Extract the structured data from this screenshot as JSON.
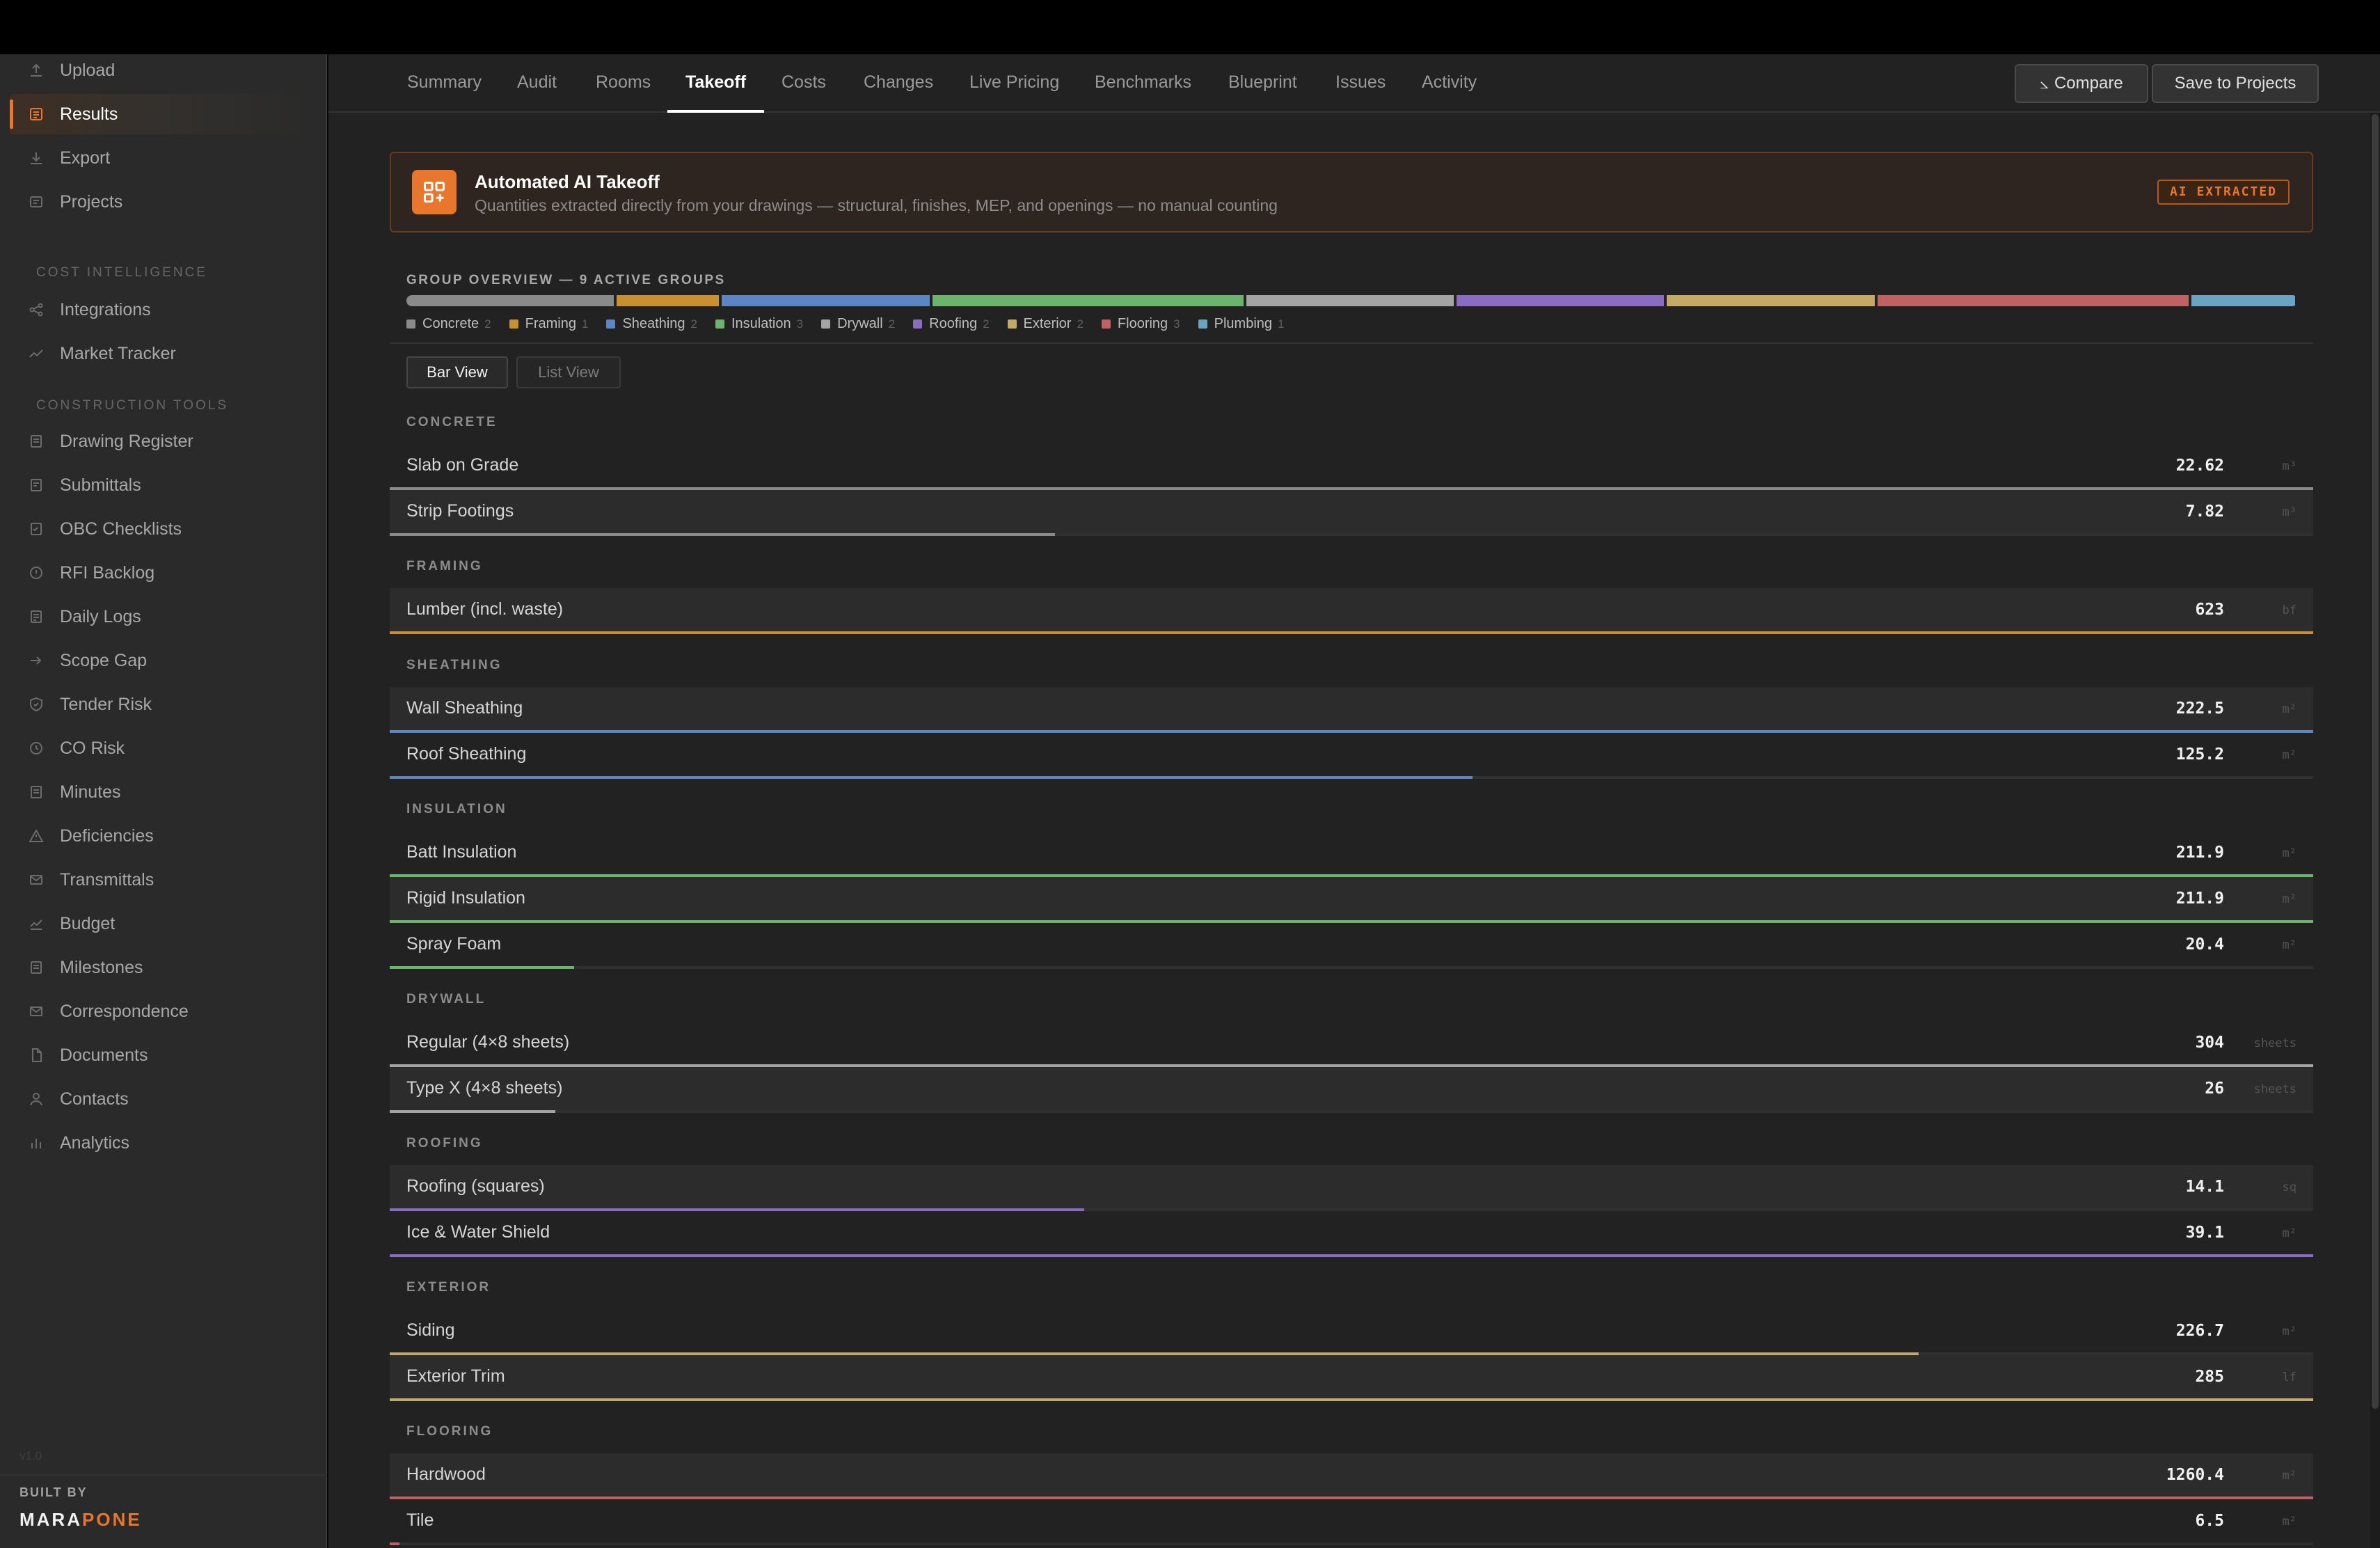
{
  "sidebar": {
    "top_items": [
      {
        "label": "Upload",
        "icon": "upload-icon"
      },
      {
        "label": "Results",
        "icon": "results-icon",
        "active": true
      },
      {
        "label": "Export",
        "icon": "export-icon"
      },
      {
        "label": "Projects",
        "icon": "projects-icon"
      }
    ],
    "cost_intelligence_heading": "COST INTELLIGENCE",
    "cost_items": [
      {
        "label": "Integrations",
        "icon": "integrations-icon"
      },
      {
        "label": "Market Tracker",
        "icon": "market-tracker-icon"
      }
    ],
    "construction_tools_heading": "CONSTRUCTION TOOLS",
    "tool_items": [
      {
        "label": "Drawing Register",
        "icon": "drawing-register-icon"
      },
      {
        "label": "Submittals",
        "icon": "submittals-icon"
      },
      {
        "label": "OBC Checklists",
        "icon": "checklist-icon"
      },
      {
        "label": "RFI Backlog",
        "icon": "rfi-icon"
      },
      {
        "label": "Daily Logs",
        "icon": "daily-logs-icon"
      },
      {
        "label": "Scope Gap",
        "icon": "scope-gap-icon"
      },
      {
        "label": "Tender Risk",
        "icon": "tender-risk-icon"
      },
      {
        "label": "CO Risk",
        "icon": "co-risk-icon"
      },
      {
        "label": "Minutes",
        "icon": "minutes-icon"
      },
      {
        "label": "Deficiencies",
        "icon": "deficiencies-icon"
      },
      {
        "label": "Transmittals",
        "icon": "transmittals-icon"
      },
      {
        "label": "Budget",
        "icon": "budget-icon"
      },
      {
        "label": "Milestones",
        "icon": "milestones-icon"
      },
      {
        "label": "Correspondence",
        "icon": "correspondence-icon"
      },
      {
        "label": "Documents",
        "icon": "documents-icon"
      },
      {
        "label": "Contacts",
        "icon": "contacts-icon"
      },
      {
        "label": "Analytics",
        "icon": "analytics-icon"
      }
    ],
    "version": "v1.0",
    "built_by": "BUILT BY",
    "brand_a": "MARA",
    "brand_b": "PONE"
  },
  "tabs": [
    "Summary",
    "Audit",
    "Rooms",
    "Takeoff",
    "Costs",
    "Changes",
    "Live Pricing",
    "Benchmarks",
    "Blueprint",
    "Issues",
    "Activity"
  ],
  "active_tab": "Takeoff",
  "actions": {
    "compare": "Compare",
    "save": "Save to Projects"
  },
  "banner": {
    "title": "Automated AI Takeoff",
    "subtitle": "Quantities extracted directly from your drawings — structural, finishes, MEP, and openings — no manual counting",
    "badge": "AI EXTRACTED"
  },
  "overview": {
    "title": "GROUP OVERVIEW — 9 ACTIVE GROUPS",
    "groups": [
      {
        "name": "Concrete",
        "count": "2",
        "color": "#8a8a8a"
      },
      {
        "name": "Framing",
        "count": "1",
        "color": "#c8902e"
      },
      {
        "name": "Sheathing",
        "count": "2",
        "color": "#5a86c4"
      },
      {
        "name": "Insulation",
        "count": "3",
        "color": "#6cb36c"
      },
      {
        "name": "Drywall",
        "count": "2",
        "color": "#a4a4a4"
      },
      {
        "name": "Roofing",
        "count": "2",
        "color": "#8a6cc2"
      },
      {
        "name": "Exterior",
        "count": "2",
        "color": "#c4aa66"
      },
      {
        "name": "Flooring",
        "count": "3",
        "color": "#c06262"
      },
      {
        "name": "Plumbing",
        "count": "1",
        "color": "#6aa4c4"
      }
    ]
  },
  "view_toggle": {
    "bar": "Bar View",
    "list": "List View",
    "active": "bar"
  },
  "sections": [
    {
      "heading": "CONCRETE",
      "color": "#8a8a8a",
      "items": [
        {
          "label": "Slab on Grade",
          "value": "22.62",
          "unit": "m³",
          "fraction": 1.0
        },
        {
          "label": "Strip Footings",
          "value": "7.82",
          "unit": "m³",
          "fraction": 0.346
        }
      ]
    },
    {
      "heading": "FRAMING",
      "color": "#c8902e",
      "items": [
        {
          "label": "Lumber (incl. waste)",
          "value": "623",
          "unit": "bf",
          "fraction": 1.0
        }
      ]
    },
    {
      "heading": "SHEATHING",
      "color": "#5a86c4",
      "items": [
        {
          "label": "Wall Sheathing",
          "value": "222.5",
          "unit": "m²",
          "fraction": 1.0
        },
        {
          "label": "Roof Sheathing",
          "value": "125.2",
          "unit": "m²",
          "fraction": 0.563
        }
      ]
    },
    {
      "heading": "INSULATION",
      "color": "#6cb36c",
      "items": [
        {
          "label": "Batt Insulation",
          "value": "211.9",
          "unit": "m²",
          "fraction": 1.0
        },
        {
          "label": "Rigid Insulation",
          "value": "211.9",
          "unit": "m²",
          "fraction": 1.0
        },
        {
          "label": "Spray Foam",
          "value": "20.4",
          "unit": "m²",
          "fraction": 0.096
        }
      ]
    },
    {
      "heading": "DRYWALL",
      "color": "#a4a4a4",
      "items": [
        {
          "label": "Regular (4×8 sheets)",
          "value": "304",
          "unit": "sheets",
          "fraction": 1.0
        },
        {
          "label": "Type X (4×8 sheets)",
          "value": "26",
          "unit": "sheets",
          "fraction": 0.086
        }
      ]
    },
    {
      "heading": "ROOFING",
      "color": "#8a6cc2",
      "items": [
        {
          "label": "Roofing (squares)",
          "value": "14.1",
          "unit": "sq",
          "fraction": 0.361
        },
        {
          "label": "Ice & Water Shield",
          "value": "39.1",
          "unit": "m²",
          "fraction": 1.0
        }
      ]
    },
    {
      "heading": "EXTERIOR",
      "color": "#c4aa66",
      "items": [
        {
          "label": "Siding",
          "value": "226.7",
          "unit": "m²",
          "fraction": 0.795
        },
        {
          "label": "Exterior Trim",
          "value": "285",
          "unit": "lf",
          "fraction": 1.0
        }
      ]
    },
    {
      "heading": "FLOORING",
      "color": "#c06262",
      "items": [
        {
          "label": "Hardwood",
          "value": "1260.4",
          "unit": "m²",
          "fraction": 1.0
        },
        {
          "label": "Tile",
          "value": "6.5",
          "unit": "m²",
          "fraction": 0.005
        }
      ]
    }
  ]
}
